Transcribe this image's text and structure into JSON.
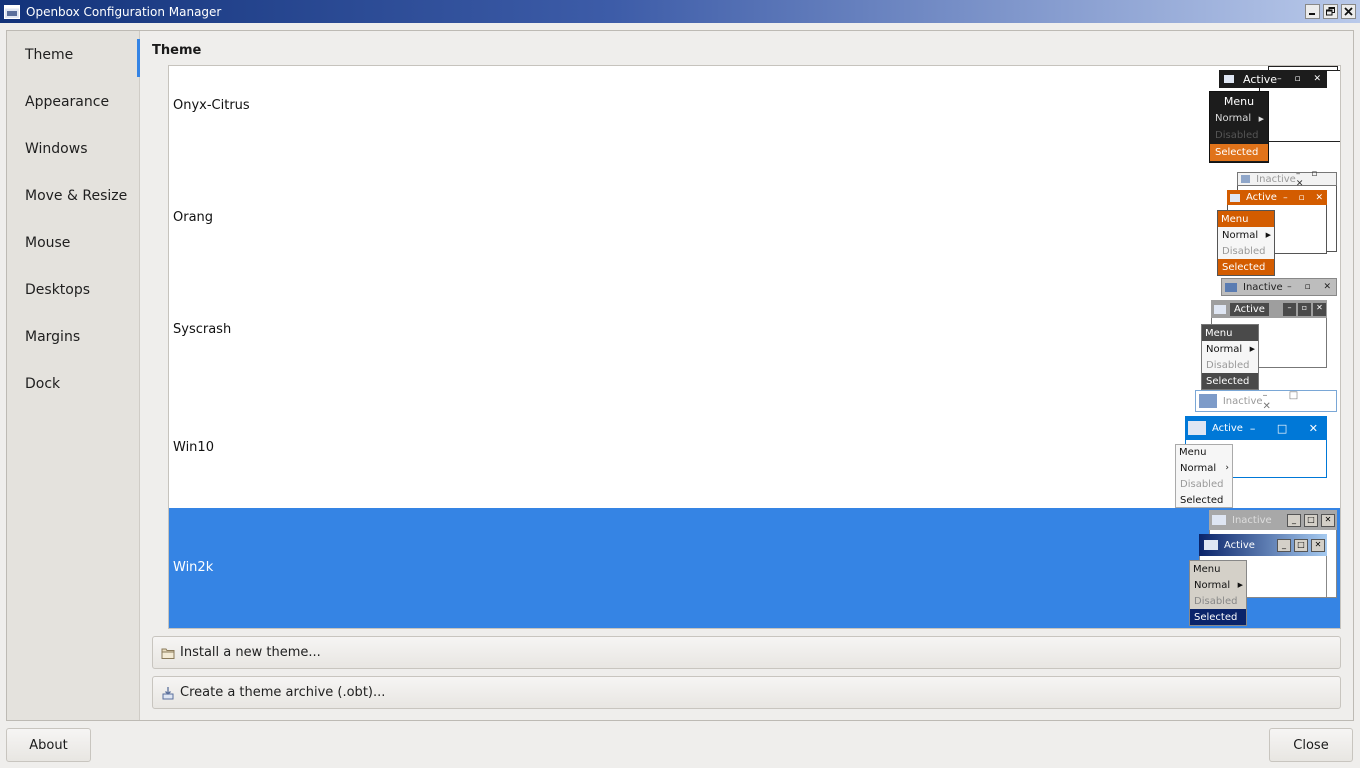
{
  "window": {
    "title": "Openbox Configuration Manager"
  },
  "sidebar": {
    "items": [
      {
        "label": "Theme"
      },
      {
        "label": "Appearance"
      },
      {
        "label": "Windows"
      },
      {
        "label": "Move & Resize"
      },
      {
        "label": "Mouse"
      },
      {
        "label": "Desktops"
      },
      {
        "label": "Margins"
      },
      {
        "label": "Dock"
      }
    ],
    "active": "Theme"
  },
  "main": {
    "title": "Theme",
    "themes": [
      {
        "name": "Onyx-Citrus",
        "selected": false
      },
      {
        "name": "Orang",
        "selected": false
      },
      {
        "name": "Syscrash",
        "selected": false
      },
      {
        "name": "Win10",
        "selected": false
      },
      {
        "name": "Win2k",
        "selected": true
      }
    ],
    "preview_labels": {
      "inactive": "Inactive",
      "active": "Active",
      "menu": "Menu",
      "normal": "Normal",
      "disabled": "Disabled",
      "selected": "Selected"
    },
    "install_button": "Install a new theme...",
    "archive_button": "Create a theme archive (.obt)..."
  },
  "footer": {
    "about_button": "About",
    "close_button": "Close"
  },
  "colors": {
    "accent": "#3584e4",
    "titlebar_start": "#13337a",
    "orange": "#d35c00",
    "win10_blue": "#0078d7",
    "win2k_blue": "#0a246a"
  },
  "icons": {
    "app": "window-icon",
    "install": "folder-icon",
    "archive": "archive-icon",
    "minimize": "minimize-icon",
    "maximize": "maximize-icon",
    "close": "close-icon"
  }
}
